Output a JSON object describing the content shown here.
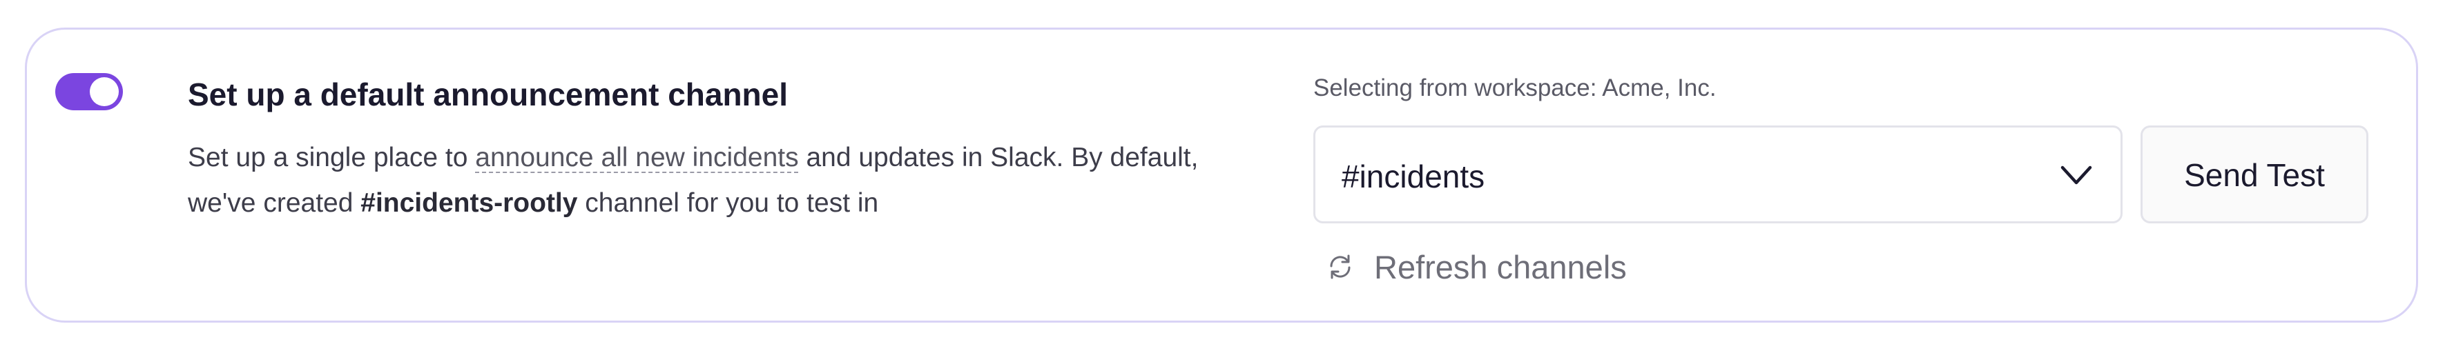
{
  "toggle": {
    "state": "on"
  },
  "title": "Set up a default announcement channel",
  "description": {
    "part1": "Set up a single place to ",
    "link": "announce all new incidents",
    "part2": " and updates in Slack. By default, we've created ",
    "channel": "#incidents-rootly",
    "part3": " channel for you to test in"
  },
  "workspace_label": "Selecting from workspace: Acme, Inc.",
  "channel_select": {
    "value": "#incidents",
    "icon": "chevron-down-icon"
  },
  "send_test_label": "Send Test",
  "refresh": {
    "label": "Refresh channels",
    "icon": "refresh-icon"
  },
  "colors": {
    "accent": "#7b45e0",
    "card_border": "#d9d3f6",
    "text": "#1b1a2e",
    "muted": "#6e6e78"
  }
}
